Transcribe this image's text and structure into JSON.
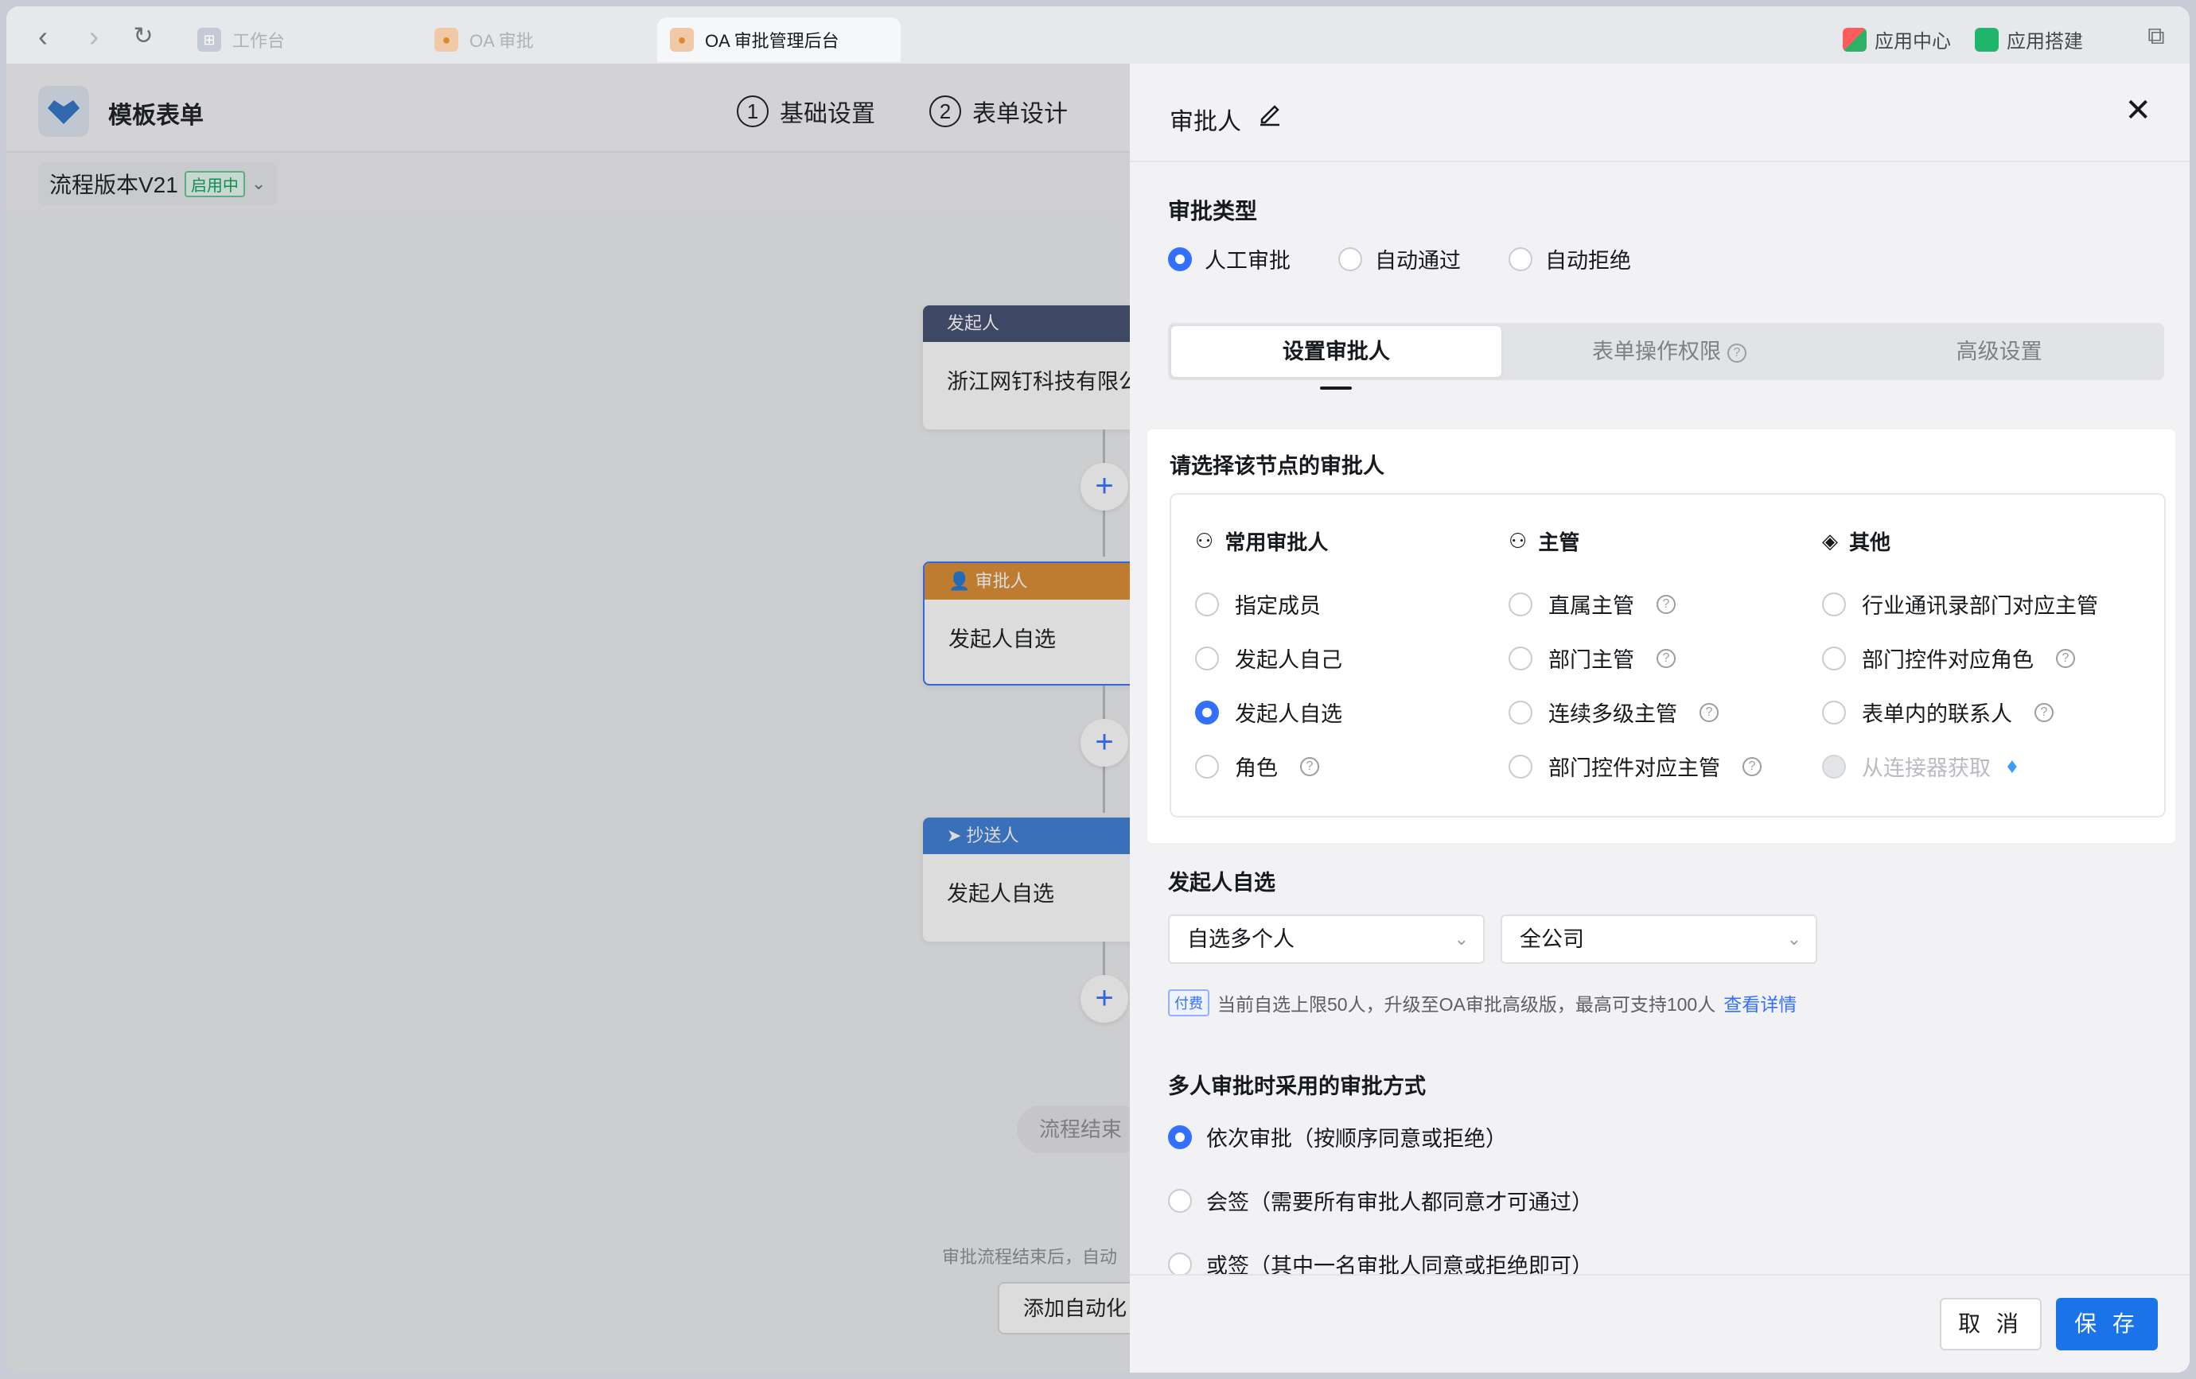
{
  "browser": {
    "tabs": [
      {
        "label": "工作台"
      },
      {
        "label": "OA 审批"
      },
      {
        "label": "OA 审批管理后台"
      }
    ],
    "right": {
      "app_center": "应用中心",
      "app_build": "应用搭建"
    }
  },
  "app": {
    "title": "模板表单",
    "steps": [
      {
        "num": "1",
        "label": "基础设置"
      },
      {
        "num": "2",
        "label": "表单设计"
      }
    ],
    "version": {
      "label": "流程版本V21",
      "badge": "启用中"
    }
  },
  "flow": {
    "nodes": [
      {
        "head": "发起人",
        "body": "浙江网钉科技有限公"
      },
      {
        "head": "审批人",
        "body": "发起人自选"
      },
      {
        "head": "抄送人",
        "body": "发起人自选"
      }
    ],
    "end_label": "流程结束",
    "note": "审批流程结束后，自动",
    "auto_button": "添加自动化"
  },
  "drawer": {
    "title": "审批人",
    "approval_type": {
      "label": "审批类型",
      "options": [
        "人工审批",
        "自动通过",
        "自动拒绝"
      ],
      "selected": "人工审批"
    },
    "tabs": [
      "设置审批人",
      "表单操作权限",
      "高级设置"
    ],
    "picker": {
      "title": "请选择该节点的审批人",
      "columns": [
        {
          "head": "常用审批人",
          "items": [
            "指定成员",
            "发起人自己",
            "发起人自选",
            "角色"
          ]
        },
        {
          "head": "主管",
          "items": [
            "直属主管",
            "部门主管",
            "连续多级主管",
            "部门控件对应主管"
          ]
        },
        {
          "head": "其他",
          "items": [
            "行业通讯录部门对应主管",
            "部门控件对应角色",
            "表单内的联系人",
            "从连接器获取"
          ]
        }
      ],
      "selected": "发起人自选"
    },
    "self_select": {
      "label": "发起人自选",
      "select1": "自选多个人",
      "select2": "全公司",
      "pay_tag": "付费",
      "tip": "当前自选上限50人，升级至OA审批高级版，最高可支持100人",
      "tip_link": "查看详情"
    },
    "multi_mode": {
      "label": "多人审批时采用的审批方式",
      "options": [
        "依次审批（按顺序同意或拒绝）",
        "会签（需要所有审批人都同意才可通过）",
        "或签（其中一名审批人同意或拒绝即可）"
      ],
      "selected": 0
    },
    "footer": {
      "cancel": "取 消",
      "save": "保 存"
    }
  },
  "colors": {
    "accent": "#3370ff",
    "save": "#1a74e8",
    "start_node": "#3f4a6b",
    "approver_node": "#d98a2b",
    "cc_node": "#3a7bd5"
  }
}
